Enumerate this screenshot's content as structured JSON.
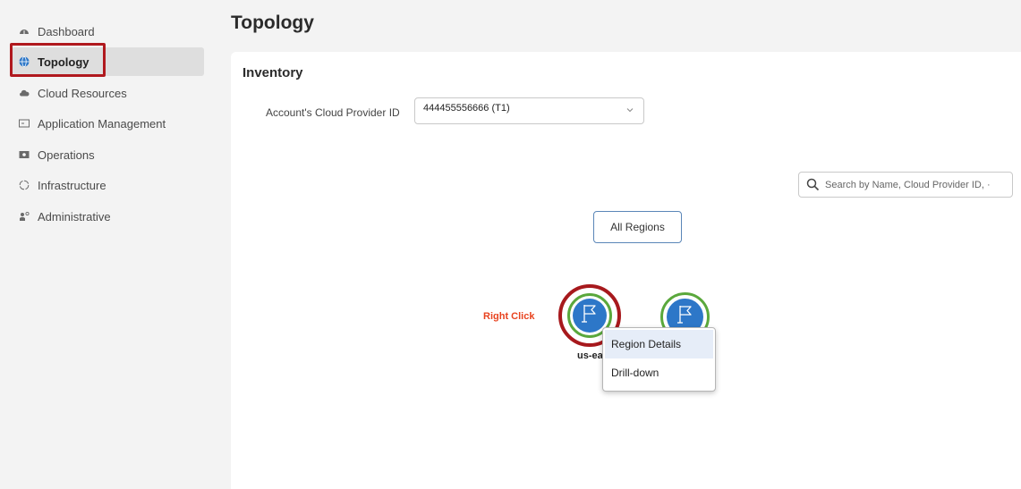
{
  "sidebar": {
    "items": [
      {
        "label": "Dashboard",
        "icon": "dashboard-icon",
        "active": false
      },
      {
        "label": "Topology",
        "icon": "globe-icon",
        "active": true
      },
      {
        "label": "Cloud Resources",
        "icon": "cloud-icon",
        "active": false
      },
      {
        "label": "Application Management",
        "icon": "app-window-icon",
        "active": false
      },
      {
        "label": "Operations",
        "icon": "operations-icon",
        "active": false
      },
      {
        "label": "Infrastructure",
        "icon": "infrastructure-icon",
        "active": false
      },
      {
        "label": "Administrative",
        "icon": "admin-icon",
        "active": false
      }
    ]
  },
  "header": {
    "title": "Topology"
  },
  "inventory": {
    "title": "Inventory",
    "provider_label": "Account's Cloud Provider ID",
    "provider_value": "444455556666 (T1)"
  },
  "search": {
    "placeholder": "Search by Name, Cloud Provider ID, ·"
  },
  "topology": {
    "all_regions_label": "All Regions",
    "annotation": "Right Click",
    "node_label": "us-east"
  },
  "context_menu": {
    "items": [
      {
        "label": "Region Details"
      },
      {
        "label": "Drill-down"
      }
    ]
  },
  "colors": {
    "highlight": "#b0191e",
    "annotation": "#e8431f",
    "node_fill": "#2d77c8",
    "node_ring": "#5aa83c",
    "active_nav_bg": "#dedede"
  }
}
